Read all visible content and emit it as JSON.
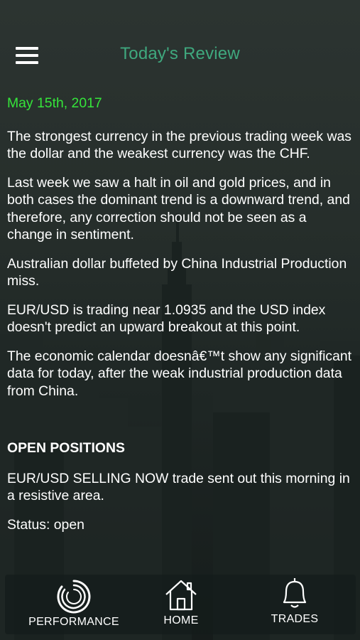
{
  "header": {
    "title": "Today's Review"
  },
  "article": {
    "date": "May 15th, 2017",
    "paragraphs": [
      "The strongest currency in the previous trading week was the dollar and the weakest currency was the CHF.",
      "Last week we saw a halt in oil and gold prices, and in both cases the dominant trend is a downward trend, and therefore, any correction should not be seen as a change in sentiment.",
      "Australian dollar buffeted by China Industrial Production miss.",
      "EUR/USD is trading near 1.0935 and the USD index doesn't predict an upward breakout at this point.",
      "The economic calendar doesnâ€™t show any significant data for today, after the weak industrial production data from China."
    ],
    "open_positions_heading": "OPEN POSITIONS",
    "position_text": "EUR/USD SELLING NOW trade sent out this morning in a resistive area.",
    "status_text": "Status: open"
  },
  "tabbar": {
    "performance": "PERFORMANCE",
    "home": "HOME",
    "trades": "TRADES"
  },
  "colors": {
    "title": "#3fa87e",
    "date": "#35e53a",
    "text": "#ffffff"
  },
  "icons": [
    "menu-icon",
    "performance-icon",
    "home-icon",
    "bell-icon"
  ]
}
